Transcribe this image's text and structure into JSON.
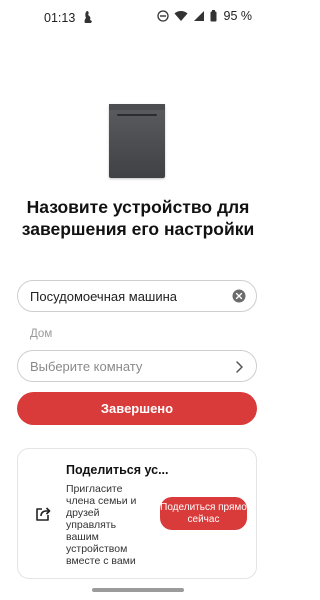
{
  "status_bar": {
    "time": "01:13",
    "battery_text": "95 %",
    "icons": [
      "dnd-icon",
      "wifi-icon",
      "signal-icon",
      "battery-icon"
    ]
  },
  "device": {
    "image_alt": "dishwasher"
  },
  "setup": {
    "headline": "Назовите устройство для завершения его настройки",
    "name_value": "Посудомоечная машина",
    "room_label": "Дом",
    "room_placeholder": "Выберите комнату",
    "done_label": "Завершено"
  },
  "share": {
    "title": "Поделиться ус...",
    "text": "Пригласите члена семьи и друзей управлять вашим устройством вместе с вами",
    "button_label": "Поделиться прямо сейчас"
  },
  "colors": {
    "accent": "#d93a3a"
  }
}
